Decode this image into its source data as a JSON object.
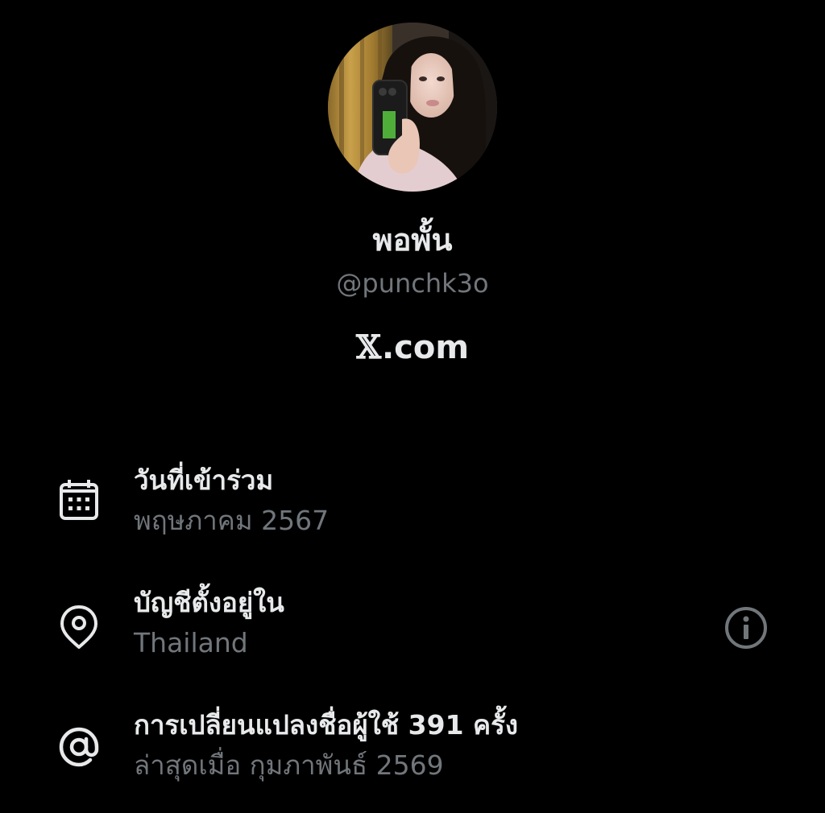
{
  "profile": {
    "display_name": "พอพั้น",
    "handle": "@punchk3o",
    "brand_x": "𝕏",
    "brand_domain": ".com",
    "avatar_icon": "profile-photo"
  },
  "about": {
    "joined": {
      "icon": "calendar-icon",
      "title": "วันที่เข้าร่วม",
      "value": "พฤษภาคม 2567"
    },
    "location": {
      "icon": "location-pin-icon",
      "title": "บัญชีตั้งอยู่ใน",
      "value": "Thailand",
      "info_icon": "info-icon"
    },
    "username_changes": {
      "icon": "at-sign-icon",
      "title": "การเปลี่ยนแปลงชื่อผู้ใช้ 391 ครั้ง",
      "value": "ล่าสุดเมื่อ กุมภาพันธ์ 2569"
    }
  },
  "colors": {
    "background": "#000000",
    "primary_text": "#e7e9ea",
    "secondary_text": "#71767b"
  }
}
